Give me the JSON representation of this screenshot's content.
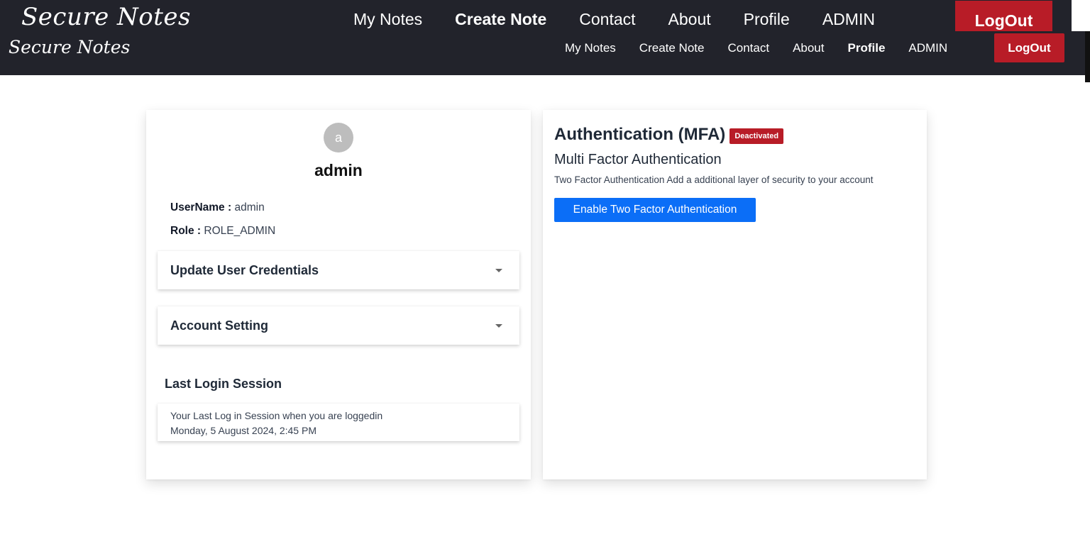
{
  "nav_top": {
    "brand": "Secure Notes",
    "links": [
      "My Notes",
      "Create Note",
      "Contact",
      "About",
      "Profile",
      "ADMIN"
    ],
    "active": "Create Note",
    "logout_label": "LogOut"
  },
  "nav_main": {
    "brand": "Secure Notes",
    "links": [
      "My Notes",
      "Create Note",
      "Contact",
      "About",
      "Profile",
      "ADMIN"
    ],
    "active": "Profile",
    "logout_label": "LogOut"
  },
  "profile": {
    "avatar_letter": "a",
    "name": "admin",
    "username_label": "UserName :",
    "username_value": "admin",
    "role_label": "Role :",
    "role_value": "ROLE_ADMIN",
    "update_credentials_label": "Update User Credentials",
    "account_setting_label": "Account Setting",
    "caret_icon": "caret-down-icon",
    "last_login_title": "Last Login Session",
    "last_login_text": "Your Last Log in Session when you are loggedin",
    "last_login_date": "Monday, 5 August 2024, 2:45 PM"
  },
  "mfa": {
    "title": "Authentication (MFA)",
    "status_badge": "Deactivated",
    "subtitle": "Multi Factor Authentication",
    "description": "Two Factor Authentication Add a additional layer of security to your account",
    "enable_button": "Enable Two Factor Authentication"
  },
  "colors": {
    "navbar_bg": "#22232b",
    "logout_bg": "#b81c27",
    "badge_bg": "#b81c27",
    "primary_button": "#0b6ef7",
    "avatar_bg": "#bdbdbd"
  }
}
